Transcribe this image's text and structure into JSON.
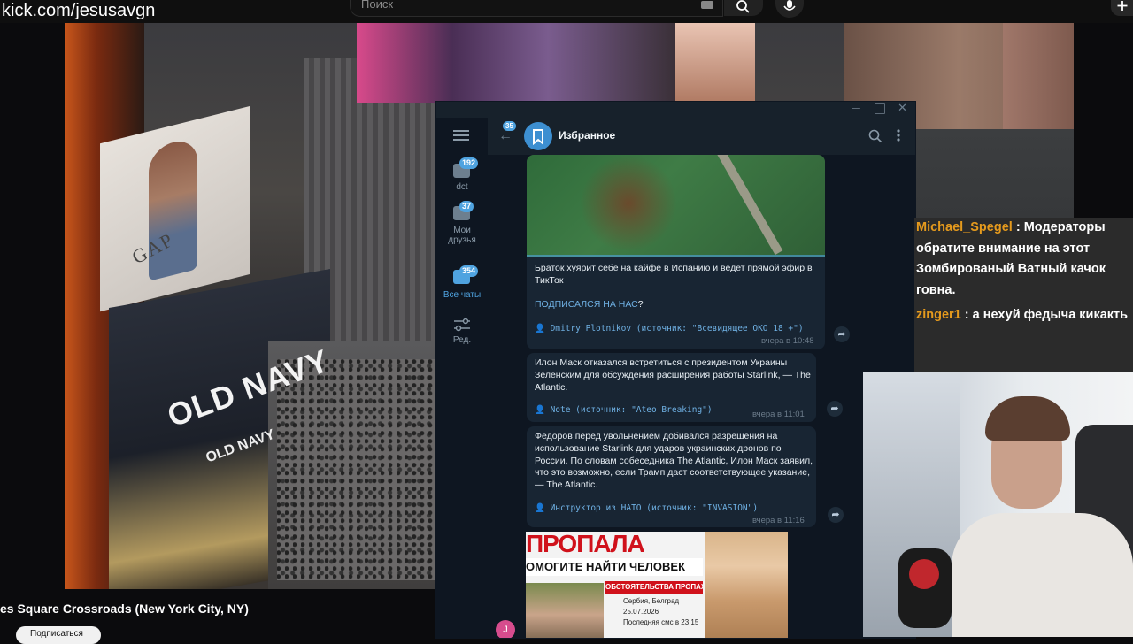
{
  "browser": {
    "url": "kick.com/jesusavgn",
    "search_placeholder": "Поиск"
  },
  "video": {
    "title": "es Square Crossroads (New York City, NY)",
    "subscribe_label": "Подписаться",
    "billboards": {
      "gap": "GAP",
      "old_navy_main": "OLD NAVY",
      "old_navy_small": "OLD NAVY"
    }
  },
  "telegram": {
    "back_badge": "35",
    "chat_title": "Избранное",
    "sidebar": [
      {
        "label": "dct",
        "badge": "192"
      },
      {
        "label": "Мои друзья",
        "badge": "37"
      },
      {
        "label": "Все чаты",
        "badge": "354",
        "active": true
      },
      {
        "label": "Ред.",
        "badge": ""
      }
    ],
    "messages": [
      {
        "text": "Браток хуярит себе на кайфе в Испанию и ведет прямой эфир в ТикТок",
        "link": "ПОДПИСАЛСЯ НА НАС",
        "link_suffix": "?",
        "source": "Dmitry Plotnikov (источник: \"Всевидящее ОКО 18 +\")",
        "time": "вчера в 10:48"
      },
      {
        "text": "Илон Маск отказался встретиться с президентом Украины Зеленским для обсуждения расширения работы Starlink, — The Atlantic.",
        "source": "Note (источник: \"Ateo Breaking\")",
        "time": "вчера в 11:01"
      },
      {
        "text": "Федоров перед увольнением добивался разрешения на использование Starlink для ударов украинских дронов по России. По словам собеседника The Atlantic, Илон Маск заявил, что это возможно, если Трамп даст соответствующее указание, — The Atlantic.",
        "source": "Инструктор из НАТО (источник: \"INVASION\")",
        "time": "вчера в 11:16"
      }
    ],
    "poster": {
      "headline": "ПРОПАЛА",
      "subline": "ОМОГИТЕ НАЙТИ ЧЕЛОВЕК",
      "circumstances": "ОБСТОЯТЕЛЬСТВА ПРОПАЖ",
      "city": "Сербия, Белград",
      "date": "25.07.2026",
      "last_sms": "Последняя смс в 23:15"
    },
    "avatar_letter": "J"
  },
  "chat_overlay": [
    {
      "user": "Michael_Spegel",
      "message": "Модераторы обратите внимание на этот Зомбированый Ватный качок говна."
    },
    {
      "user": "zinger1",
      "message": "а нехуй федыча кикакть"
    }
  ],
  "colors": {
    "telegram_bg": "#0e1621",
    "telegram_panel": "#17212b",
    "telegram_bubble": "#182533",
    "telegram_accent": "#4fa3e0",
    "chat_username": "#e59a1d"
  }
}
